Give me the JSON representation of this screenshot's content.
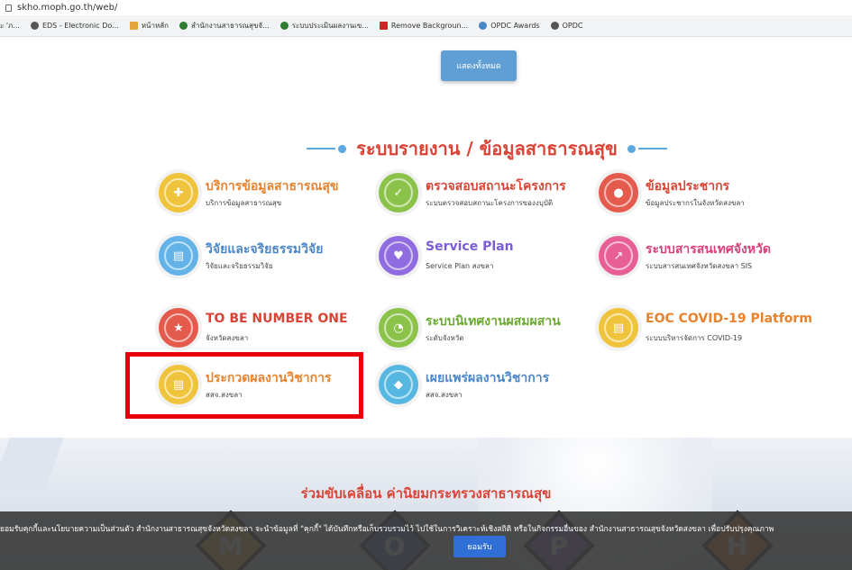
{
  "browser": {
    "url": "skho.moph.go.th/web/",
    "bookmarks": [
      {
        "label": "ะ 'ภ...",
        "icon": "page-icon"
      },
      {
        "label": "EDS - Electronic Do...",
        "icon": "globe-icon"
      },
      {
        "label": "หน้าหลัก",
        "icon": "grid-icon"
      },
      {
        "label": "สำนักงานสาธารณสุขจั...",
        "icon": "gear-icon"
      },
      {
        "label": "ระบบประเมินผลงานเข...",
        "icon": "gear-icon"
      },
      {
        "label": "Remove Backgroun...",
        "icon": "remove-bg-icon"
      },
      {
        "label": "OPDC Awards",
        "icon": "award-icon"
      },
      {
        "label": "OPDC",
        "icon": "globe-icon"
      }
    ]
  },
  "top": {
    "show_all_label": "แสดงทั้งหมด"
  },
  "section": {
    "title": "ระบบรายงาน / ข้อมูลสาธารณสุข"
  },
  "services": [
    {
      "title": "บริการข้อมูลสาธารณสุข",
      "subtitle": "บริการข้อมูลสาธารณสุข",
      "icon": "medical-bag-icon",
      "color": "#f0c33c"
    },
    {
      "title": "ตรวจสอบสถานะโครงการ",
      "subtitle": "ระบบตรวจสอบสถานะโครงการของงบุบัติ",
      "icon": "check-icon",
      "color": "#8bc34a"
    },
    {
      "title": "ข้อมูลประชากร",
      "subtitle": "ข้อมูลประชากรในจังหวัดสงขลา",
      "icon": "users-icon",
      "color": "#e45a4c"
    },
    {
      "title": "วิจัยและจริยธรรมวิจัย",
      "subtitle": "วิจัยและจริยธรรมวิจัย",
      "icon": "document-icon",
      "color": "#63b3e8"
    },
    {
      "title": "Service Plan",
      "subtitle": "Service Plan สงขลา",
      "icon": "heart-icon",
      "color": "#8f6de0"
    },
    {
      "title": "ระบบสารสนเทศจังหวัด",
      "subtitle": "ระบบสารสนเทศจังหวัดสงขลา SIS",
      "icon": "chart-icon",
      "color": "#e85f96"
    },
    {
      "title": "TO BE NUMBER ONE",
      "subtitle": "จังหวัดสงขลา",
      "icon": "star-icon",
      "color": "#e45a4c"
    },
    {
      "title": "ระบบนิเทศงานผสมผสาน",
      "subtitle": "ระดับจังหวัด",
      "icon": "pie-chart-icon",
      "color": "#8bc34a"
    },
    {
      "title": "EOC COVID-19 Platform",
      "subtitle": "ระบบบริหารจัดการ COVID-19",
      "icon": "document-icon",
      "color": "#f0c33c"
    },
    {
      "title": "ประกวดผลงานวิชาการ",
      "subtitle": "สสจ.สงขลา",
      "icon": "document-icon",
      "color": "#f0c33c"
    },
    {
      "title": "เผยแพร่ผลงานวิชาการ",
      "subtitle": "สสจ.สงขลา",
      "icon": "tag-icon",
      "color": "#56b8e0"
    }
  ],
  "banner": {
    "title": "ร่วมขับเคลื่อน ค่านิยมกระทรวงสาธารณสุข",
    "letters": [
      "M",
      "O",
      "P",
      "H"
    ]
  },
  "cookie": {
    "message": "ยอมรับคุกกี้และนโยบายความเป็นส่วนตัว สำนักงานสาธารณสุขจังหวัดสงขลา จะนำข้อมูลที่ \"คุกกี้\" ได้บันทึกหรือเก็บรวบรวมไว้ ไปใช้ในการวิเคราะห์เชิงสถิติ หรือในกิจกรรมอื่นของ สำนักงานสาธารณสุขจังหวัดสงขลา เพื่อปรับปรุงคุณภาพ",
    "accept_label": "ยอมรับ"
  }
}
